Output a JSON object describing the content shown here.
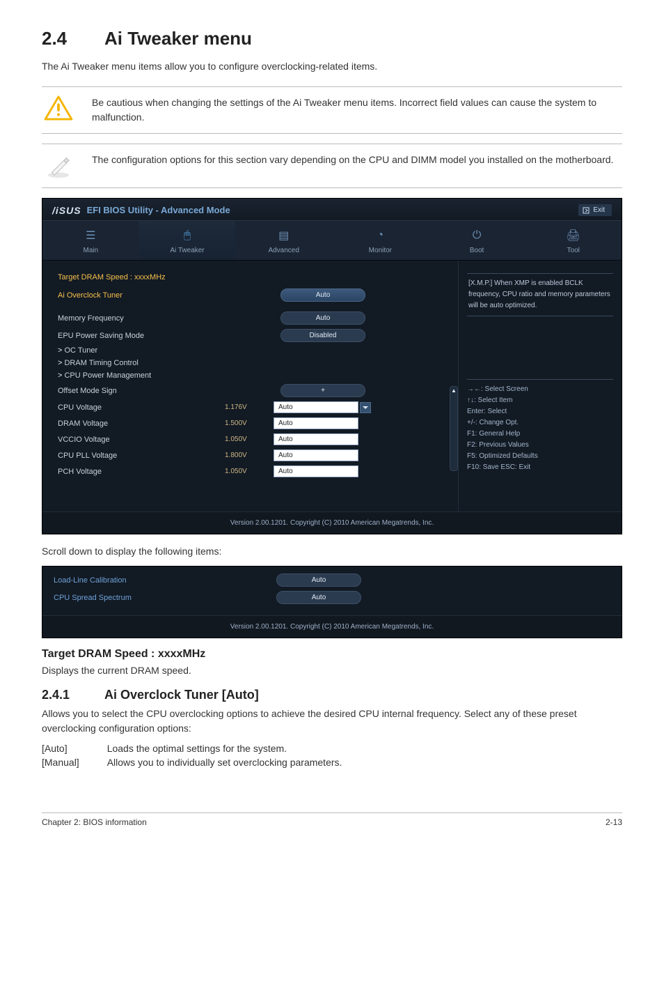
{
  "heading": {
    "num": "2.4",
    "title": "Ai Tweaker menu"
  },
  "intro": "The Ai Tweaker menu items allow you to configure overclocking-related items.",
  "note_warn": "Be cautious when changing the settings of the Ai Tweaker menu items. Incorrect field values can cause the system to malfunction.",
  "note_info": "The configuration options for this section vary depending on the CPU and DIMM model you installed on the motherboard.",
  "bios": {
    "title_logo": "/iSUS",
    "title_text": "EFI BIOS Utility - Advanced Mode",
    "exit": "Exit",
    "tabs": {
      "main": "Main",
      "tweaker": "Ai  Tweaker",
      "advanced": "Advanced",
      "monitor": "Monitor",
      "boot": "Boot",
      "tool": "Tool"
    },
    "target": "Target DRAM Speed : xxxxMHz",
    "ai_overclock": {
      "label": "Ai Overclock Tuner",
      "value": "Auto"
    },
    "rows": {
      "memory_freq": {
        "label": "Memory Frequency",
        "pill": "Auto"
      },
      "epu": {
        "label": "EPU Power Saving Mode",
        "pill": "Disabled"
      },
      "oc_tuner": "OC Tuner",
      "dram_timing": "DRAM Timing Control",
      "cpu_pm": "CPU Power Management",
      "offset": {
        "label": "Offset Mode Sign",
        "pill": "+"
      },
      "cpu_v": {
        "label": "CPU Voltage",
        "val": "1.176V",
        "input": "Auto"
      },
      "dram_v": {
        "label": "DRAM Voltage",
        "val": "1.500V",
        "input": "Auto"
      },
      "vccio": {
        "label": "VCCIO Voltage",
        "val": "1.050V",
        "input": "Auto"
      },
      "cpupll": {
        "label": "CPU PLL Voltage",
        "val": "1.800V",
        "input": "Auto"
      },
      "pch": {
        "label": "PCH Voltage",
        "val": "1.050V",
        "input": "Auto"
      }
    },
    "hint": "[X.M.P.] When XMP is enabled BCLK frequency, CPU ratio and memory parameters will be auto optimized.",
    "keys": {
      "k1": "→←: Select Screen",
      "k2": "↑↓: Select Item",
      "k3": "Enter: Select",
      "k4": "+/-: Change Opt.",
      "k5": "F1: General Help",
      "k6": "F2: Previous Values",
      "k7": "F5: Optimized Defaults",
      "k8": "F10: Save   ESC: Exit"
    },
    "footer": "Version  2.00.1201.  Copyright  (C)  2010  American  Megatrends,  Inc."
  },
  "scroll_hint": "Scroll down to display the following items:",
  "bios2": {
    "llc": {
      "label": "Load-Line Calibration",
      "pill": "Auto"
    },
    "spread": {
      "label": "CPU Spread Spectrum",
      "pill": "Auto"
    }
  },
  "section_target": {
    "heading": "Target DRAM Speed : xxxxMHz",
    "body": "Displays the current DRAM speed."
  },
  "section_241": {
    "num": "2.4.1",
    "title": "Ai Overclock Tuner [Auto]",
    "body": "Allows you to select the CPU overclocking options to achieve the desired CPU internal frequency. Select any of these preset overclocking configuration options:",
    "opts": {
      "auto": {
        "k": "[Auto]",
        "v": "Loads the optimal settings for the system."
      },
      "manual": {
        "k": "[Manual]",
        "v": "Allows you to individually set overclocking parameters."
      }
    }
  },
  "pagefoot": {
    "left": "Chapter 2: BIOS information",
    "right": "2-13"
  }
}
